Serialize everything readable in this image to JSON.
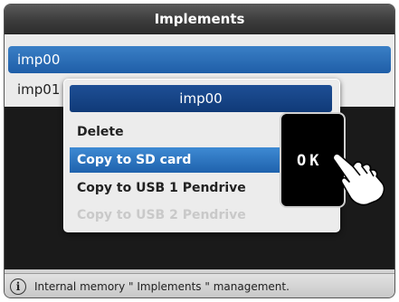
{
  "window": {
    "title": "Implements"
  },
  "list": {
    "items": [
      {
        "label": "imp00",
        "selected": true
      },
      {
        "label": "imp01",
        "selected": false
      }
    ]
  },
  "popup": {
    "title": "imp00",
    "items": [
      {
        "label": "Delete",
        "state": "normal"
      },
      {
        "label": "Copy to SD card",
        "state": "highlighted"
      },
      {
        "label": "Copy to USB 1 Pendrive",
        "state": "normal"
      },
      {
        "label": "Copy to USB 2 Pendrive",
        "state": "disabled"
      }
    ]
  },
  "ok_button": {
    "label": "OK"
  },
  "hand": {
    "icon": "pointing-hand-icon"
  },
  "status": {
    "icon": "info-icon",
    "info_glyph": "i",
    "text": "Internal memory \" Implements \" management."
  },
  "colors": {
    "selection": "#2a6fbd",
    "popup_header": "#173f7f",
    "titlebar": "#444444"
  }
}
